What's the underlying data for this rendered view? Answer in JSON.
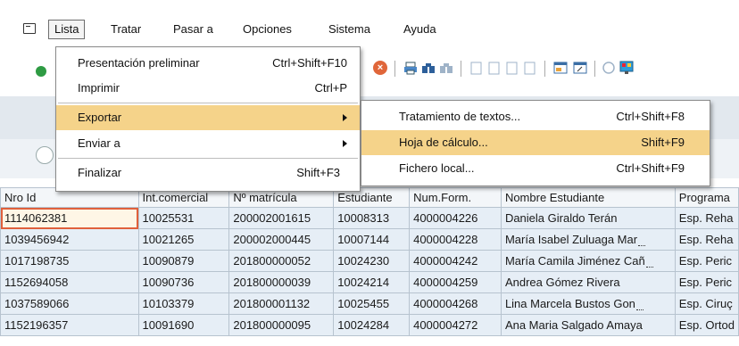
{
  "menubar": {
    "items": [
      {
        "label": "Lista",
        "active": true
      },
      {
        "label": "Tratar",
        "active": false
      },
      {
        "label": "Pasar a",
        "active": false
      },
      {
        "label": "Opciones",
        "active": false
      },
      {
        "label": "Sistema",
        "active": false
      },
      {
        "label": "Ayuda",
        "active": false
      }
    ]
  },
  "toolbar": {
    "icons": [
      "ok-icon",
      "cancel-icon",
      "print-icon",
      "find-icon",
      "find-next-icon",
      "first-page-icon",
      "prev-page-icon",
      "next-page-icon",
      "last-page-icon",
      "new-session-icon",
      "shortcut-icon",
      "help-icon",
      "layout-icon"
    ]
  },
  "lista_menu": {
    "items": [
      {
        "label": "Presentación preliminar",
        "shortcut": "Ctrl+Shift+F10",
        "submenu": false
      },
      {
        "label": "Imprimir",
        "shortcut": "Ctrl+P",
        "submenu": false
      },
      {
        "label": "Exportar",
        "shortcut": "",
        "submenu": true,
        "highlighted": true
      },
      {
        "label": "Enviar a",
        "shortcut": "",
        "submenu": true
      },
      {
        "label": "Finalizar",
        "shortcut": "Shift+F3",
        "submenu": false
      }
    ]
  },
  "exportar_menu": {
    "items": [
      {
        "label": "Tratamiento de textos...",
        "shortcut": "Ctrl+Shift+F8"
      },
      {
        "label": "Hoja de cálculo...",
        "shortcut": "Shift+F9",
        "highlighted": true
      },
      {
        "label": "Fichero local...",
        "shortcut": "Ctrl+Shift+F9"
      }
    ]
  },
  "table": {
    "columns": [
      "Nro Id",
      "Int.comercial",
      "Nº matrícula",
      "Estudiante",
      "Num.Form.",
      "Nombre Estudiante",
      "Programa"
    ],
    "rows": [
      [
        "1114062381",
        "10025531",
        "200002001615",
        "10008313",
        "4000004226",
        "Daniela Giraldo Terán",
        "Esp. Reha"
      ],
      [
        "1039456942",
        "10021265",
        "200002000445",
        "10007144",
        "4000004228",
        "María Isabel Zuluaga Mar",
        "Esp. Reha"
      ],
      [
        "1017198735",
        "10090879",
        "201800000052",
        "10024230",
        "4000004242",
        "María Camila Jiménez Cañ",
        "Esp. Peric"
      ],
      [
        "1152694058",
        "10090736",
        "201800000039",
        "10024214",
        "4000004259",
        "Andrea Gómez Rivera",
        "Esp. Peric"
      ],
      [
        "1037589066",
        "10103379",
        "201800001132",
        "10025455",
        "4000004268",
        "Lina Marcela Bustos Gon",
        "Esp. Ciruç"
      ],
      [
        "1152196357",
        "10091690",
        "201800000095",
        "10024284",
        "4000004272",
        "Ana Maria Salgado Amaya",
        "Esp. Ortod"
      ]
    ]
  },
  "colors": {
    "menu_highlight": "#f5d38a",
    "grid_cell_bg": "#e6eef6",
    "selected_cell_border": "#e0603c"
  }
}
